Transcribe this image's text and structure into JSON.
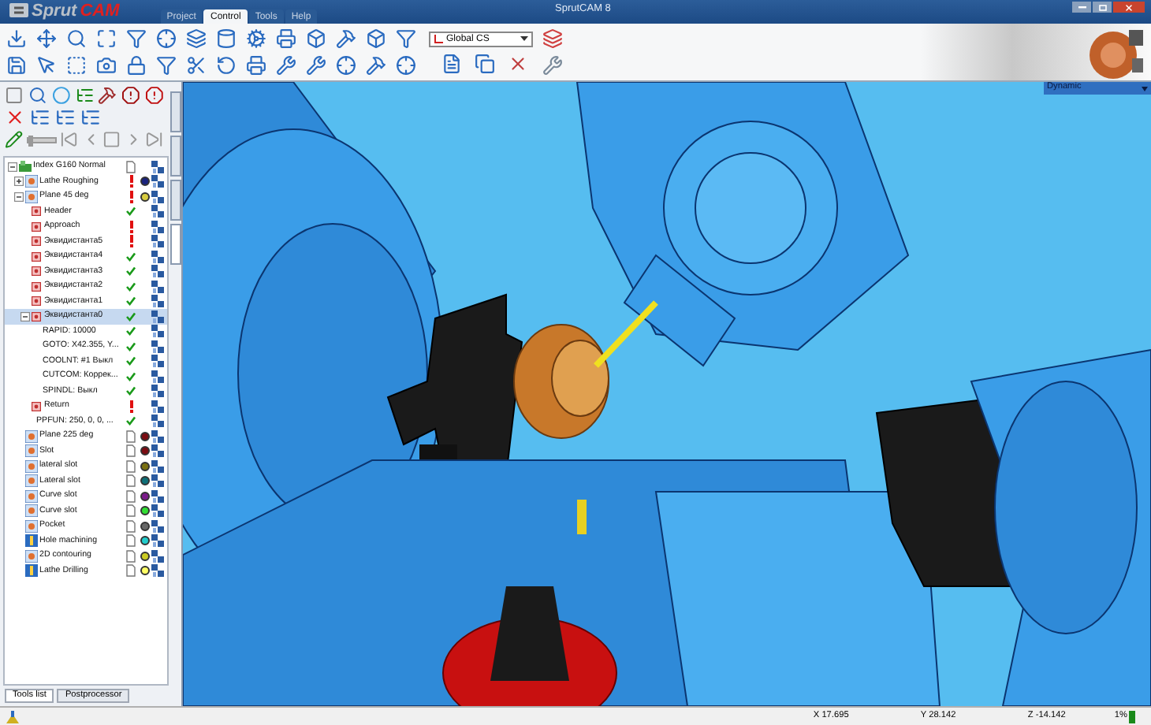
{
  "window": {
    "title": "SprutCAM 8",
    "logo": [
      "Sprut",
      "CAM"
    ]
  },
  "menu_tabs": [
    {
      "label": "Project",
      "selected": false
    },
    {
      "label": "Control",
      "selected": true
    },
    {
      "label": "Tools",
      "selected": false
    },
    {
      "label": "Help",
      "selected": false
    }
  ],
  "toolbar": {
    "coordinate_system": "Global CS"
  },
  "simulation": {
    "level": 0
  },
  "side_tabs": [
    {
      "selected": false
    },
    {
      "selected": false
    },
    {
      "selected": false
    },
    {
      "selected": true
    }
  ],
  "tree": [
    {
      "label": "Index G160 Normal",
      "kind": "root",
      "calculated": false,
      "warning": false,
      "selected": false,
      "expanded": true,
      "children": [
        {
          "label": "Lathe Roughing",
          "kind": "operation",
          "warning": true,
          "color": "#1a237e",
          "selected": false,
          "expanded": false
        },
        {
          "label": "Plane 45 deg",
          "kind": "operation",
          "warning": true,
          "color": "#d8cc40",
          "selected": false,
          "expanded": true,
          "children": [
            {
              "label": "Header",
              "kind": "step",
              "calculated": true,
              "warning": false,
              "selected": false
            },
            {
              "label": "Approach",
              "kind": "step",
              "warning": true,
              "selected": false
            },
            {
              "label": "Эквидистанта5",
              "kind": "step",
              "warning": true,
              "selected": false
            },
            {
              "label": "Эквидистанта4",
              "kind": "step",
              "calculated": true,
              "warning": false,
              "selected": false
            },
            {
              "label": "Эквидистанта3",
              "kind": "step",
              "calculated": true,
              "warning": false,
              "selected": false
            },
            {
              "label": "Эквидистанта2",
              "kind": "step",
              "calculated": true,
              "warning": false,
              "selected": false
            },
            {
              "label": "Эквидистанта1",
              "kind": "step",
              "calculated": true,
              "warning": false,
              "selected": false
            },
            {
              "label": "Эквидистанта0",
              "kind": "step",
              "calculated": true,
              "warning": false,
              "selected": true,
              "expanded": true,
              "children": [
                {
                  "label": "RAPID: 10000",
                  "kind": "command",
                  "calculated": true,
                  "warning": false,
                  "selected": false
                },
                {
                  "label": "GOTO: X42.355, Y...",
                  "kind": "command",
                  "calculated": true,
                  "warning": false,
                  "selected": false
                },
                {
                  "label": "COOLNT: #1 Выкл",
                  "kind": "command",
                  "calculated": true,
                  "warning": false,
                  "selected": false
                },
                {
                  "label": "CUTCOM: Коррек...",
                  "kind": "command",
                  "calculated": true,
                  "warning": false,
                  "selected": false
                },
                {
                  "label": "SPINDL: Выкл",
                  "kind": "command",
                  "calculated": true,
                  "warning": false,
                  "selected": false
                }
              ]
            },
            {
              "label": "Return",
              "kind": "step",
              "warning": true,
              "selected": false
            },
            {
              "label": "PPFUN: 250, 0, 0, ...",
              "kind": "command",
              "calculated": true,
              "warning": false,
              "selected": false
            }
          ]
        },
        {
          "label": "Plane 225 deg",
          "kind": "operation",
          "calculated": false,
          "warning": false,
          "color": "#7b0c12",
          "selected": false
        },
        {
          "label": "Slot",
          "kind": "operation",
          "calculated": false,
          "warning": false,
          "color": "#7b0c12",
          "selected": false
        },
        {
          "label": "lateral slot",
          "kind": "operation",
          "calculated": false,
          "warning": false,
          "color": "#7a7010",
          "selected": false
        },
        {
          "label": "Lateral slot",
          "kind": "operation",
          "calculated": false,
          "warning": false,
          "color": "#0e6f78",
          "selected": false
        },
        {
          "label": "Curve slot",
          "kind": "operation",
          "calculated": false,
          "warning": false,
          "color": "#7b1a8a",
          "selected": false
        },
        {
          "label": "Curve slot",
          "kind": "operation",
          "calculated": false,
          "warning": false,
          "color": "#33dd33",
          "selected": false
        },
        {
          "label": "Pocket",
          "kind": "operation",
          "calculated": false,
          "warning": false,
          "color": "#666666",
          "selected": false
        },
        {
          "label": "Hole machining",
          "kind": "drilling",
          "calculated": false,
          "warning": false,
          "color": "#22cccc",
          "selected": false
        },
        {
          "label": "2D contouring",
          "kind": "operation",
          "calculated": false,
          "warning": false,
          "color": "#cccc22",
          "selected": false
        },
        {
          "label": "Lathe Drilling",
          "kind": "drilling",
          "calculated": false,
          "warning": false,
          "color": "#ffff66",
          "selected": false
        }
      ]
    }
  ],
  "bottom_tabs": [
    {
      "label": "Tools list",
      "selected": true
    },
    {
      "label": "Postprocessor",
      "selected": false
    }
  ],
  "viewport": {
    "view_mode": "Dynamic"
  },
  "status_bar": {
    "x": "X 17.695",
    "y": "Y 28.142",
    "z": "Z -14.142",
    "progress": "1%"
  }
}
